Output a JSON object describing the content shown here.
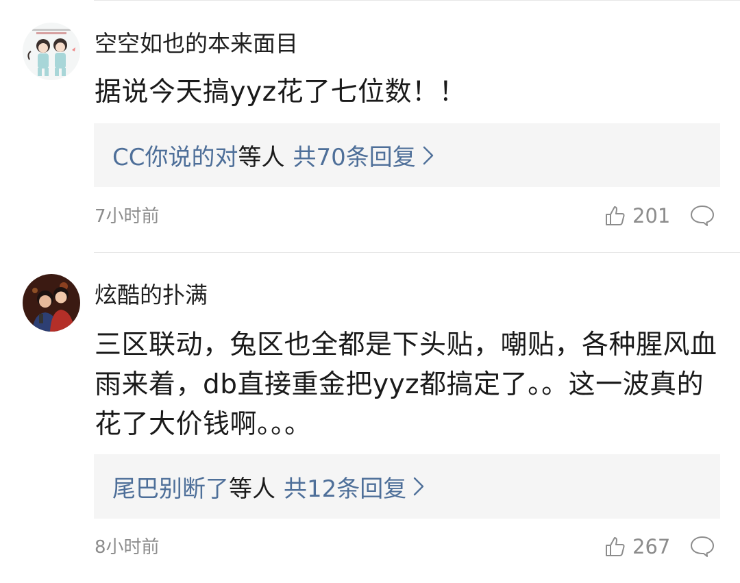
{
  "comments": [
    {
      "username": "空空如也的本来面目",
      "content": "据说今天搞yyz花了七位数！！",
      "replies": {
        "users": "CC你说的对",
        "suffix": "等人",
        "count_text": "共70条回复"
      },
      "timestamp": "7小时前",
      "likes": "201",
      "avatar_icon": "cartoon-couple-avatar"
    },
    {
      "username": "炫酷的扑满",
      "content": "三区联动，兔区也全都是下头贴，嘲贴，各种腥风血雨来着，db直接重金把yyz都搞定了。。这一波真的花了大价钱啊。。。",
      "replies": {
        "users": "尾巴别断了",
        "suffix": "等人",
        "count_text": "共12条回复"
      },
      "timestamp": "8小时前",
      "likes": "267",
      "avatar_icon": "photo-avatar"
    }
  ],
  "icons": {
    "like": "thumb-up-icon",
    "reply": "speech-bubble-icon",
    "more": "chevron-right-icon"
  },
  "colors": {
    "link": "#4e6f99",
    "meta": "#8c8c8c",
    "reply_bg": "#f5f5f5"
  }
}
